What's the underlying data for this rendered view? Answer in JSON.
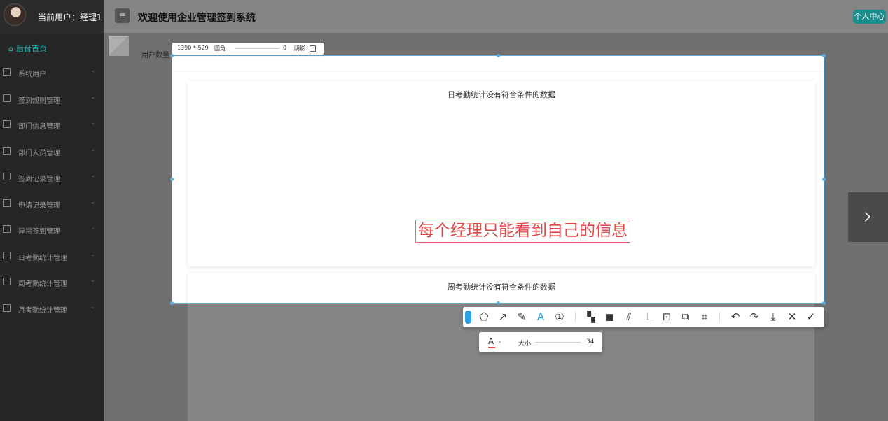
{
  "header": {
    "current_user": "当前用户：经理1",
    "menu_toggle_icon": "menu-icon",
    "title": "欢迎使用企业管理签到系统",
    "user_center": "个人中心"
  },
  "sidebar": {
    "home": "后台首页",
    "items": [
      {
        "label": "系统用户"
      },
      {
        "label": "签到规则管理"
      },
      {
        "label": "部门信息管理"
      },
      {
        "label": "部门人员管理"
      },
      {
        "label": "签到记录管理"
      },
      {
        "label": "申请记录管理"
      },
      {
        "label": "异常签到管理"
      },
      {
        "label": "日考勤统计管理"
      },
      {
        "label": "周考勤统计管理"
      },
      {
        "label": "月考勤统计管理"
      }
    ]
  },
  "main": {
    "user_count_label": "用户数量"
  },
  "capture": {
    "size": "1390 * 529",
    "radius_label": "圆角",
    "radius_value": "0",
    "shadow_label": "阴影",
    "shadow_checked": false
  },
  "cards": {
    "daily_empty": "日考勤统计没有符合条件的数据",
    "weekly_empty": "周考勤统计没有符合条件的数据"
  },
  "annotation": {
    "text": "每个经理只能看到自己的信息",
    "color": "#e24848"
  },
  "toolbar": {
    "tools": [
      "shape-icon",
      "arrow-icon",
      "pen-icon",
      "text-icon",
      "number-icon",
      "mosaic-icon",
      "blur-icon",
      "pattern-icon",
      "pin-icon",
      "ocr-icon",
      "translate-icon",
      "text-recognize-icon",
      "undo-icon",
      "redo-icon",
      "download-icon",
      "close-icon",
      "confirm-icon"
    ],
    "active_tool": "text-icon"
  },
  "text_options": {
    "font_color_label": "A",
    "size_label": "大小",
    "size_value": "34"
  }
}
